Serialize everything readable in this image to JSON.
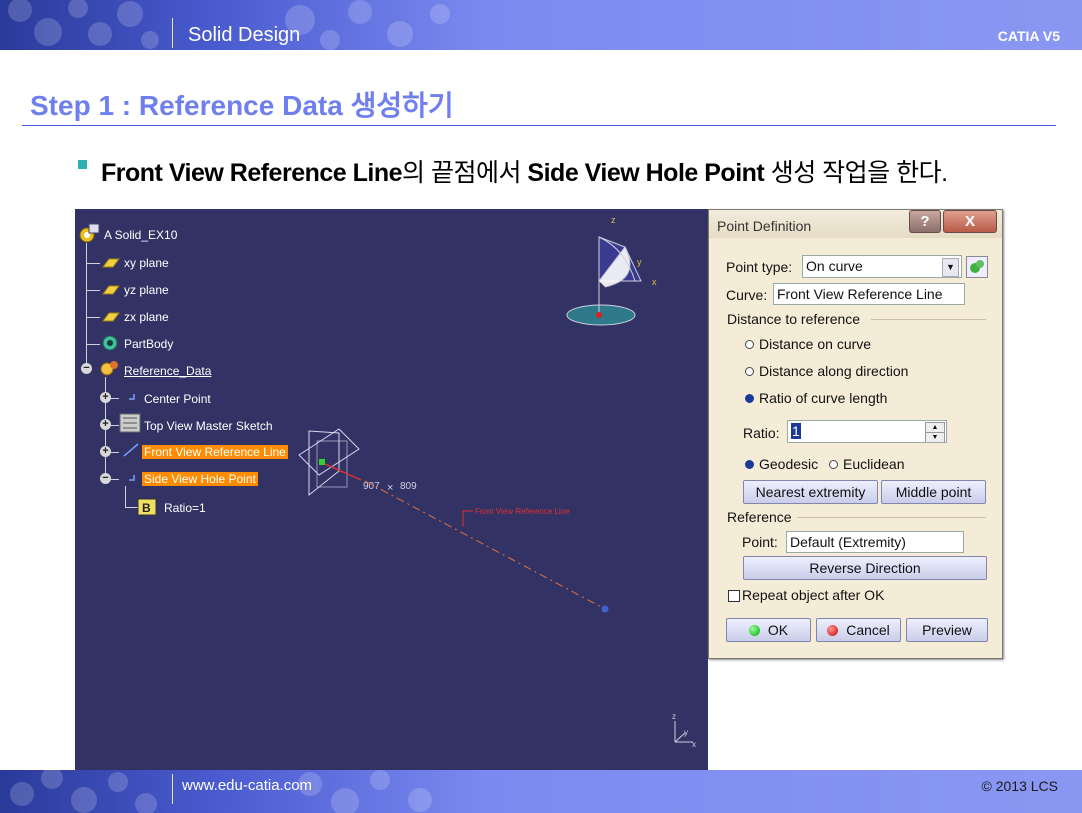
{
  "header": {
    "title": "Solid Design",
    "brand": "CATIA V5"
  },
  "footer": {
    "website": "www.edu-catia.com",
    "copyright": "© 2013 LCS"
  },
  "slide": {
    "step_title": "Step 1 : Reference Data 생성하기",
    "bullet": {
      "part1": "Front View Reference Line",
      "part2": "의 끝점에서 ",
      "part3": "Side View Hole Point",
      "part4": " 생성 작업을 한다."
    }
  },
  "tree": {
    "root": "A Solid_EX10",
    "xy": "xy plane",
    "yz": "yz plane",
    "zx": "zx plane",
    "partbody": "PartBody",
    "reference_data": "Reference_Data",
    "center_point": "Center Point",
    "top_view_sketch": "Top View Master Sketch",
    "front_view_line": "Front View Reference Line",
    "side_view_hole": "Side View Hole Point",
    "ratio": "Ratio=1"
  },
  "viewport": {
    "dim1": "907",
    "dim2": "809",
    "line_label": "Front View Reference Line",
    "axis_z": "z",
    "axis_y": "y",
    "axis_x": "x"
  },
  "dialog": {
    "title": "Point Definition",
    "help": "?",
    "close": "X",
    "point_type_label": "Point type:",
    "point_type_value": "On curve",
    "curve_label": "Curve:",
    "curve_value": "Front View Reference Line",
    "distance_group": "Distance to reference",
    "opt_distance_on_curve": "Distance on curve",
    "opt_distance_along": "Distance along direction",
    "opt_ratio": "Ratio of curve length",
    "ratio_label": "Ratio:",
    "ratio_value": "1",
    "geodesic": "Geodesic",
    "euclidean": "Euclidean",
    "nearest_btn": "Nearest extremity",
    "middle_btn": "Middle point",
    "reference_group": "Reference",
    "point_label": "Point:",
    "point_value": "Default (Extremity)",
    "reverse_btn": "Reverse Direction",
    "repeat_label": "Repeat object after OK",
    "ok": "OK",
    "cancel": "Cancel",
    "preview": "Preview"
  },
  "colors": {
    "banner": "#4a5bd0",
    "step_title": "#6f7ff0",
    "viewport_bg": "#323264",
    "highlight": "#ff8c00",
    "dialog_bg": "#f5ecd8"
  }
}
